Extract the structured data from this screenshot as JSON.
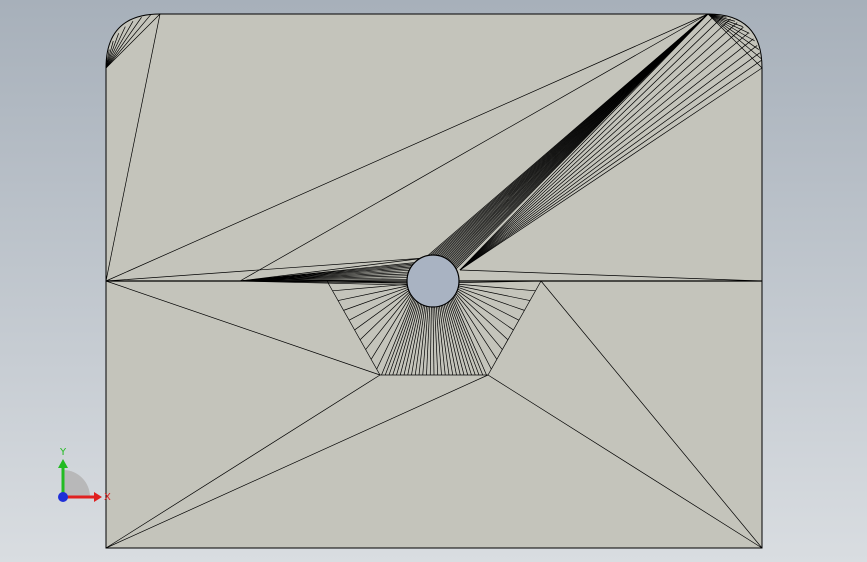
{
  "viewport": {
    "background_top": "#a7b0ba",
    "background_bottom": "#d9dde1",
    "part_fill": "#c4c4bb",
    "edge_color": "#000000",
    "hole_fill": "#a9b3c2"
  },
  "triad": {
    "x_label": "X",
    "y_label": "Y",
    "x_color": "#e02020",
    "y_color": "#22bb22",
    "z_color": "#1f2fd8",
    "icon": "coordinate-triad-icon"
  }
}
